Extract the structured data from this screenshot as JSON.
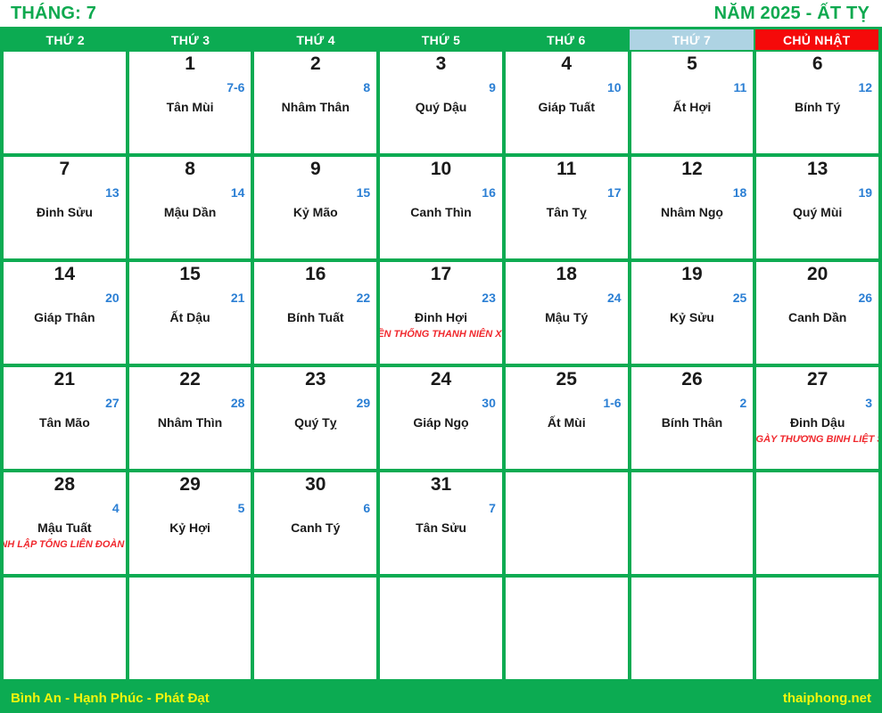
{
  "header": {
    "month_label": "THÁNG: 7",
    "year_label": "NĂM 2025 - ẤT TỴ"
  },
  "weekdays": [
    {
      "label": "THỨ 2",
      "kind": "weekday"
    },
    {
      "label": "THỨ 3",
      "kind": "weekday"
    },
    {
      "label": "THỨ 4",
      "kind": "weekday"
    },
    {
      "label": "THỨ 5",
      "kind": "weekday"
    },
    {
      "label": "THỨ 6",
      "kind": "weekday"
    },
    {
      "label": "THỨ 7",
      "kind": "saturday"
    },
    {
      "label": "CHỦ NHẬT",
      "kind": "sunday"
    }
  ],
  "colors": {
    "grid_green": "#0cab52",
    "title_green": "#0ea94f",
    "saturday_blue": "#aed3e3",
    "sunday_red": "#f50a0a",
    "lunar_blue": "#2b7fd4",
    "event_red": "#f0282d",
    "footer_yellow": "#f3f50d"
  },
  "weeks": [
    [
      {
        "empty": true
      },
      {
        "solar": "1",
        "lunar": "7-6",
        "canchi": "Tân Mùi"
      },
      {
        "solar": "2",
        "lunar": "8",
        "canchi": "Nhâm Thân"
      },
      {
        "solar": "3",
        "lunar": "9",
        "canchi": "Quý Dậu"
      },
      {
        "solar": "4",
        "lunar": "10",
        "canchi": "Giáp Tuất"
      },
      {
        "solar": "5",
        "lunar": "11",
        "canchi": "Ất Hợi"
      },
      {
        "solar": "6",
        "lunar": "12",
        "canchi": "Bính Tý"
      }
    ],
    [
      {
        "solar": "7",
        "lunar": "13",
        "canchi": "Đinh Sửu"
      },
      {
        "solar": "8",
        "lunar": "14",
        "canchi": "Mậu Dần"
      },
      {
        "solar": "9",
        "lunar": "15",
        "canchi": "Kỷ Mão"
      },
      {
        "solar": "10",
        "lunar": "16",
        "canchi": "Canh Thìn"
      },
      {
        "solar": "11",
        "lunar": "17",
        "canchi": "Tân Tỵ"
      },
      {
        "solar": "12",
        "lunar": "18",
        "canchi": "Nhâm Ngọ"
      },
      {
        "solar": "13",
        "lunar": "19",
        "canchi": "Quý Mùi"
      }
    ],
    [
      {
        "solar": "14",
        "lunar": "20",
        "canchi": "Giáp Thân"
      },
      {
        "solar": "15",
        "lunar": "21",
        "canchi": "Ất Dậu"
      },
      {
        "solar": "16",
        "lunar": "22",
        "canchi": "Bính Tuất"
      },
      {
        "solar": "17",
        "lunar": "23",
        "canchi": "Đinh Hợi",
        "event": "NGÀY TRUYỀN THỐNG THANH NIÊN XUNG PHONG"
      },
      {
        "solar": "18",
        "lunar": "24",
        "canchi": "Mậu Tý"
      },
      {
        "solar": "19",
        "lunar": "25",
        "canchi": "Kỷ Sửu"
      },
      {
        "solar": "20",
        "lunar": "26",
        "canchi": "Canh Dần"
      }
    ],
    [
      {
        "solar": "21",
        "lunar": "27",
        "canchi": "Tân Mão"
      },
      {
        "solar": "22",
        "lunar": "28",
        "canchi": "Nhâm Thìn"
      },
      {
        "solar": "23",
        "lunar": "29",
        "canchi": "Quý Tỵ"
      },
      {
        "solar": "24",
        "lunar": "30",
        "canchi": "Giáp Ngọ"
      },
      {
        "solar": "25",
        "lunar": "1-6",
        "canchi": "Ất Mùi"
      },
      {
        "solar": "26",
        "lunar": "2",
        "canchi": "Bính Thân"
      },
      {
        "solar": "27",
        "lunar": "3",
        "canchi": "Đinh Dậu",
        "event": "NGÀY THƯƠNG BINH LIỆT SĨ"
      }
    ],
    [
      {
        "solar": "28",
        "lunar": "4",
        "canchi": "Mậu Tuất",
        "event": "NGÀY THÀNH LẬP TỔNG LIÊN ĐOÀN LAO ĐỘNG"
      },
      {
        "solar": "29",
        "lunar": "5",
        "canchi": "Kỷ Hợi"
      },
      {
        "solar": "30",
        "lunar": "6",
        "canchi": "Canh Tý"
      },
      {
        "solar": "31",
        "lunar": "7",
        "canchi": "Tân Sửu"
      },
      {
        "empty": true
      },
      {
        "empty": true
      },
      {
        "empty": true
      }
    ],
    [
      {
        "empty": true
      },
      {
        "empty": true
      },
      {
        "empty": true
      },
      {
        "empty": true
      },
      {
        "empty": true
      },
      {
        "empty": true
      },
      {
        "empty": true
      }
    ]
  ],
  "footer": {
    "slogan": "Bình An - Hạnh Phúc - Phát Đạt",
    "site": "thaiphong.net"
  }
}
